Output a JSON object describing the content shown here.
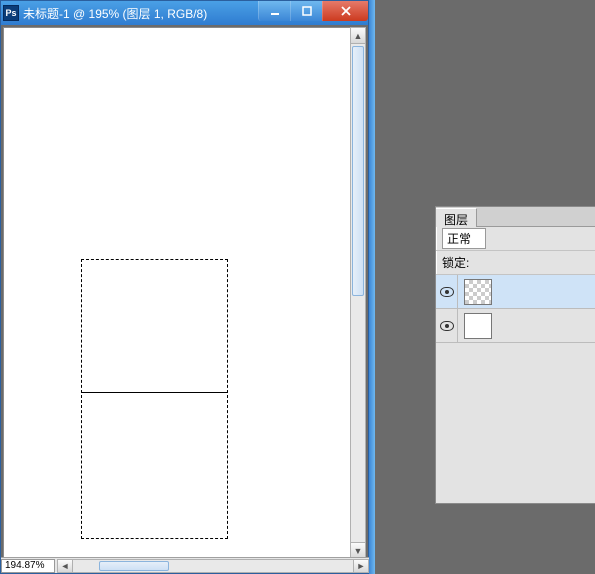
{
  "window": {
    "app_icon_label": "Ps",
    "title": "未标题-1 @ 195% (图层 1, RGB/8)"
  },
  "status": {
    "zoom": "194.87%"
  },
  "panel": {
    "tab_layers": "图层",
    "blend_mode": "正常",
    "lock_label": "锁定:"
  },
  "colors": {
    "accent": "#3b86d6"
  }
}
